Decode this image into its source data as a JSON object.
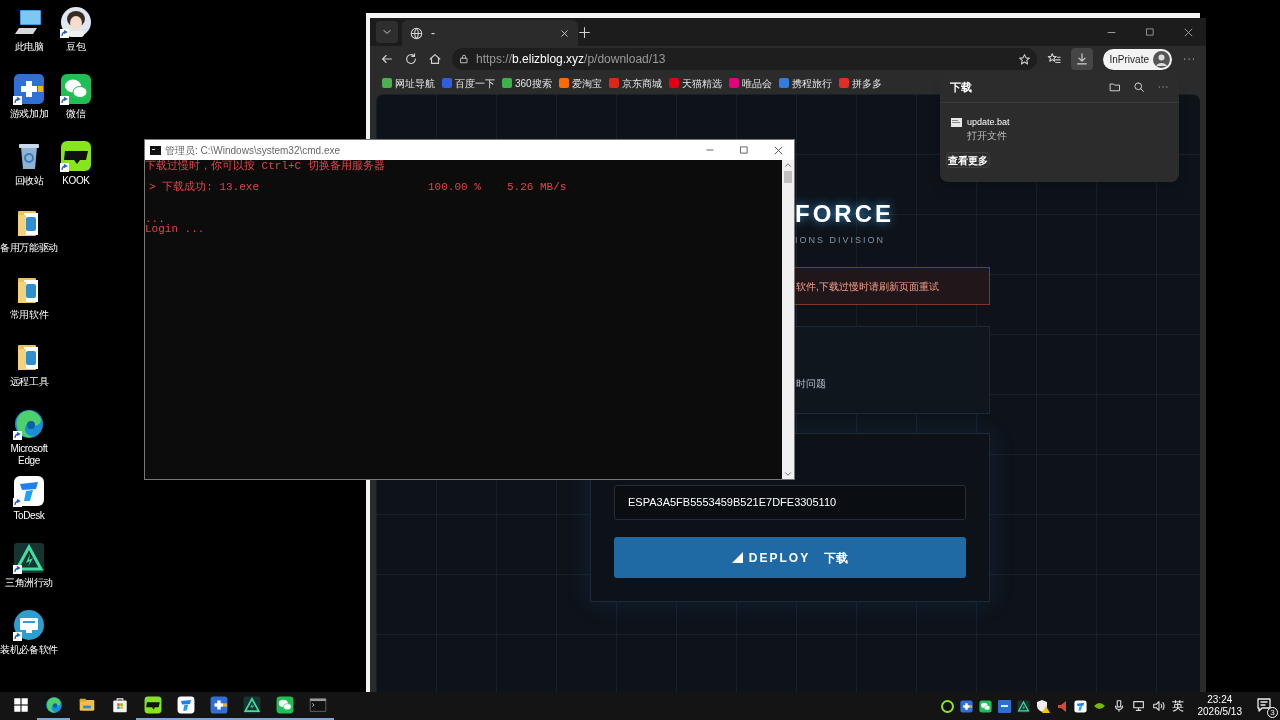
{
  "desktop": {
    "columns": [
      {
        "icons": [
          {
            "label": "此电脑",
            "kind": "pc",
            "shortcut": false
          },
          {
            "label": "游戏加加",
            "kind": "gameplus",
            "shortcut": true
          },
          {
            "label": "回收站",
            "kind": "recycle",
            "shortcut": false
          },
          {
            "label": "备用万能驱动",
            "kind": "folder",
            "shortcut": false
          },
          {
            "label": "常用软件",
            "kind": "folder",
            "shortcut": false
          },
          {
            "label": "远程工具",
            "kind": "folder",
            "shortcut": false
          },
          {
            "label": "Microsoft Edge",
            "kind": "edge",
            "shortcut": true
          },
          {
            "label": "ToDesk",
            "kind": "todesk",
            "shortcut": true
          },
          {
            "label": "三角洲行动",
            "kind": "delta",
            "shortcut": true
          },
          {
            "label": "装机必备软件",
            "kind": "tools",
            "shortcut": true
          }
        ]
      },
      {
        "icons": [
          {
            "label": "豆包",
            "kind": "doubao",
            "shortcut": true
          },
          {
            "label": "微信",
            "kind": "wechat",
            "shortcut": true
          },
          {
            "label": "KOOK",
            "kind": "kook",
            "shortcut": true
          }
        ]
      }
    ]
  },
  "browser": {
    "tab": {
      "title": "-"
    },
    "url": {
      "scheme": "https://",
      "host": "b.elizblog.xyz",
      "path": "/p/download/13"
    },
    "profile": "InPrivate",
    "bookmarks": [
      {
        "label": "网址导航",
        "color": "#4caf50"
      },
      {
        "label": "百度一下",
        "color": "#2f5fe0"
      },
      {
        "label": "360搜索",
        "color": "#3cb34a"
      },
      {
        "label": "爱淘宝",
        "color": "#ff6a00"
      },
      {
        "label": "京东商城",
        "color": "#e1251b"
      },
      {
        "label": "天猫精选",
        "color": "#e60012"
      },
      {
        "label": "唯品会",
        "color": "#e4007f"
      },
      {
        "label": "携程旅行",
        "color": "#2f7de1"
      },
      {
        "label": "拼多多",
        "color": "#e02e24"
      }
    ],
    "downloads": {
      "open": true,
      "title": "下载",
      "items": [
        {
          "name": "update.bat",
          "action": "打开文件"
        }
      ],
      "more": "查看更多"
    },
    "page": {
      "title": "FORCE",
      "subtitle": "IONS DIVISION",
      "notice": "软件,下载过慢时请刷新页面重试",
      "info": "时问题",
      "key_field": {
        "value": "ESPA3A5FB5553459B521E7DFE3305110"
      },
      "deploy_button": {
        "label": "DEPLOY",
        "sublabel": "下载"
      }
    }
  },
  "console": {
    "title": "管理员: C:\\Windows\\system32\\cmd.exe",
    "lines": [
      {
        "kind": "text",
        "text": "下载过慢时，你可以按 Ctrl+C 切换备用服务器"
      },
      {
        "kind": "blank"
      },
      {
        "kind": "row",
        "cells": [
          "> 下载成功: 13.exe",
          "100.00 %",
          "5.26 MB/s"
        ]
      },
      {
        "kind": "blank"
      },
      {
        "kind": "blank"
      },
      {
        "kind": "text",
        "text": "..."
      },
      {
        "kind": "text",
        "text": "Login ..."
      }
    ]
  },
  "taskbar": {
    "apps": [
      {
        "kind": "start",
        "running": false
      },
      {
        "kind": "edge",
        "running": true
      },
      {
        "kind": "explorer",
        "running": false
      },
      {
        "kind": "store",
        "running": false
      },
      {
        "kind": "kook",
        "running": true
      },
      {
        "kind": "todesk",
        "running": true
      },
      {
        "kind": "gameplus",
        "running": true
      },
      {
        "kind": "delta",
        "running": true
      },
      {
        "kind": "wechat",
        "running": true
      },
      {
        "kind": "cmd",
        "running": true
      }
    ],
    "ime": "英",
    "time": "23:24",
    "date": "2026/5/13",
    "notifications": "3"
  }
}
